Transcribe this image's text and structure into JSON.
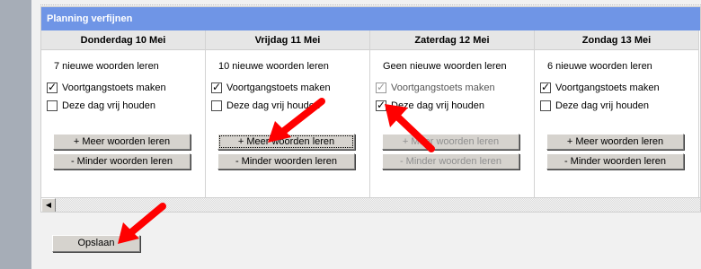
{
  "panel": {
    "title": "Planning verfijnen"
  },
  "days": [
    {
      "header": "Donderdag 10 Mei",
      "note": "7 nieuwe woorden leren",
      "progress_test": {
        "label": "Voortgangstoets maken",
        "checked": true,
        "disabled": false
      },
      "free_day": {
        "label": "Deze dag vrij houden",
        "checked": false,
        "disabled": false
      },
      "more_label": "+ Meer woorden leren",
      "less_label": "- Minder woorden leren",
      "buttons_disabled": false
    },
    {
      "header": "Vrijdag 11 Mei",
      "note": "10 nieuwe woorden leren",
      "progress_test": {
        "label": "Voortgangstoets maken",
        "checked": true,
        "disabled": false
      },
      "free_day": {
        "label": "Deze dag vrij houden",
        "checked": false,
        "disabled": false
      },
      "more_label": "+ Meer woorden leren",
      "less_label": "- Minder woorden leren",
      "buttons_disabled": false
    },
    {
      "header": "Zaterdag 12 Mei",
      "note": "Geen nieuwe woorden leren",
      "progress_test": {
        "label": "Voortgangstoets maken",
        "checked": true,
        "disabled": true
      },
      "free_day": {
        "label": "Deze dag vrij houden",
        "checked": true,
        "disabled": false
      },
      "more_label": "+ Meer woorden leren",
      "less_label": "- Minder woorden leren",
      "buttons_disabled": true
    },
    {
      "header": "Zondag 13 Mei",
      "note": "6 nieuwe woorden leren",
      "progress_test": {
        "label": "Voortgangstoets maken",
        "checked": true,
        "disabled": false
      },
      "free_day": {
        "label": "Deze dag vrij houden",
        "checked": false,
        "disabled": false
      },
      "more_label": "+ Meer woorden leren",
      "less_label": "- Minder woorden leren",
      "buttons_disabled": false
    }
  ],
  "save_label": "Opslaan",
  "colors": {
    "header_bg": "#6f95e6",
    "arrow": "#ff0000",
    "sidebar": "#a6adb7"
  },
  "icons": {
    "scroll_left": "scroll-left-arrow-icon",
    "annotation": "red-arrow-icon"
  }
}
